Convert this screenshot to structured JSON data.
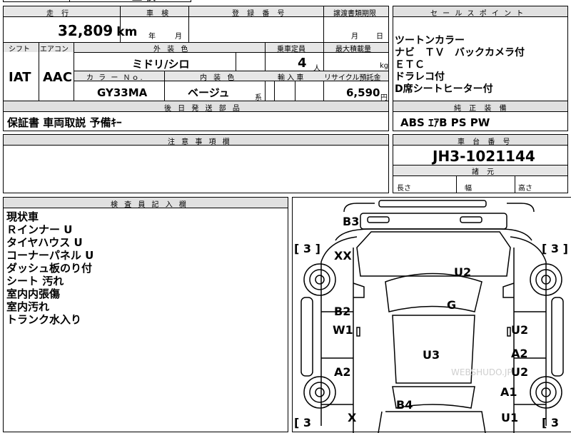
{
  "top_cut": {
    "frag1": "",
    "frag2": "直 検"
  },
  "mileage": {
    "header": "走 行",
    "value": "32,809",
    "unit": "km"
  },
  "inspection": {
    "header": "車 検",
    "year": "年",
    "month": "月"
  },
  "registration": {
    "header": "登 録 番 号"
  },
  "transfer_deadline": {
    "header": "譲渡書類期限",
    "month": "月",
    "day": "日"
  },
  "shift": {
    "header": "シフト",
    "value": "IAT"
  },
  "aircon": {
    "header": "エアコン",
    "value": "AAC"
  },
  "exterior_color": {
    "header": "外 装 色",
    "value": "ミドリ/シロ"
  },
  "capacity": {
    "header": "乗車定員",
    "value": "4",
    "unit": "人"
  },
  "max_load": {
    "header": "最大積載量",
    "unit": "kg"
  },
  "color_no": {
    "header": "カ ラ ー Ｎｏ.",
    "value": "GY33MA"
  },
  "interior_color": {
    "header": "内 装 色",
    "value": "ベージュ",
    "suffix": "系"
  },
  "import": {
    "header": "輸 入 車"
  },
  "recycle": {
    "header": "リサイクル預託金",
    "value": "6,590",
    "unit": "円"
  },
  "accessories": {
    "header": "後 日 発 送 部 品",
    "value": "保証書 車両取説 予備ｷｰ"
  },
  "sales_points": {
    "header": "セ ー ル ス ポ イ ン ト",
    "lines": [
      "ツートンカラー",
      "ナビ　ＴＶ　バックカメラ付",
      "ＥＴＣ",
      "ドラレコ付",
      "D席シートヒーター付"
    ]
  },
  "genuine": {
    "header": "純 正 装 備",
    "value": "ABS ｴｱB PS PW"
  },
  "notes": {
    "header": "注 意 事 項 欄",
    "value": ""
  },
  "chassis": {
    "header": "車 台 番 号",
    "value": "JH3-1021144"
  },
  "dims": {
    "header": "諸 元",
    "length": "長さ",
    "width": "幅",
    "height": "高さ"
  },
  "inspector": {
    "header": "検 査 員 記 入 欄",
    "lines": [
      "現状車",
      "Ｒインナー U",
      "タイヤハウス U",
      "コーナーパネル U",
      "ダッシュ板のり付",
      "シート 汚れ",
      "室内内張傷",
      "室内汚れ",
      "トランク水入り"
    ]
  },
  "diagram": {
    "labels": [
      {
        "id": "b3",
        "text": "B3"
      },
      {
        "id": "xx",
        "text": "XX"
      },
      {
        "id": "u2-top",
        "text": "U2"
      },
      {
        "id": "g",
        "text": "G"
      },
      {
        "id": "b2",
        "text": "B2"
      },
      {
        "id": "w1",
        "text": "W1"
      },
      {
        "id": "u2-right",
        "text": "U2"
      },
      {
        "id": "u3",
        "text": "U3"
      },
      {
        "id": "a2-right",
        "text": "A2"
      },
      {
        "id": "a2-left",
        "text": "A2"
      },
      {
        "id": "u2-right2",
        "text": "U2"
      },
      {
        "id": "a1",
        "text": "A1"
      },
      {
        "id": "b4",
        "text": "B4"
      },
      {
        "id": "x",
        "text": "X"
      },
      {
        "id": "u1",
        "text": "U1"
      }
    ],
    "brackets": [
      "[ 3 ]",
      "[ 3 ]",
      "[ 3",
      "[ 3"
    ],
    "watermark": "WEBSHUDO.JP"
  }
}
